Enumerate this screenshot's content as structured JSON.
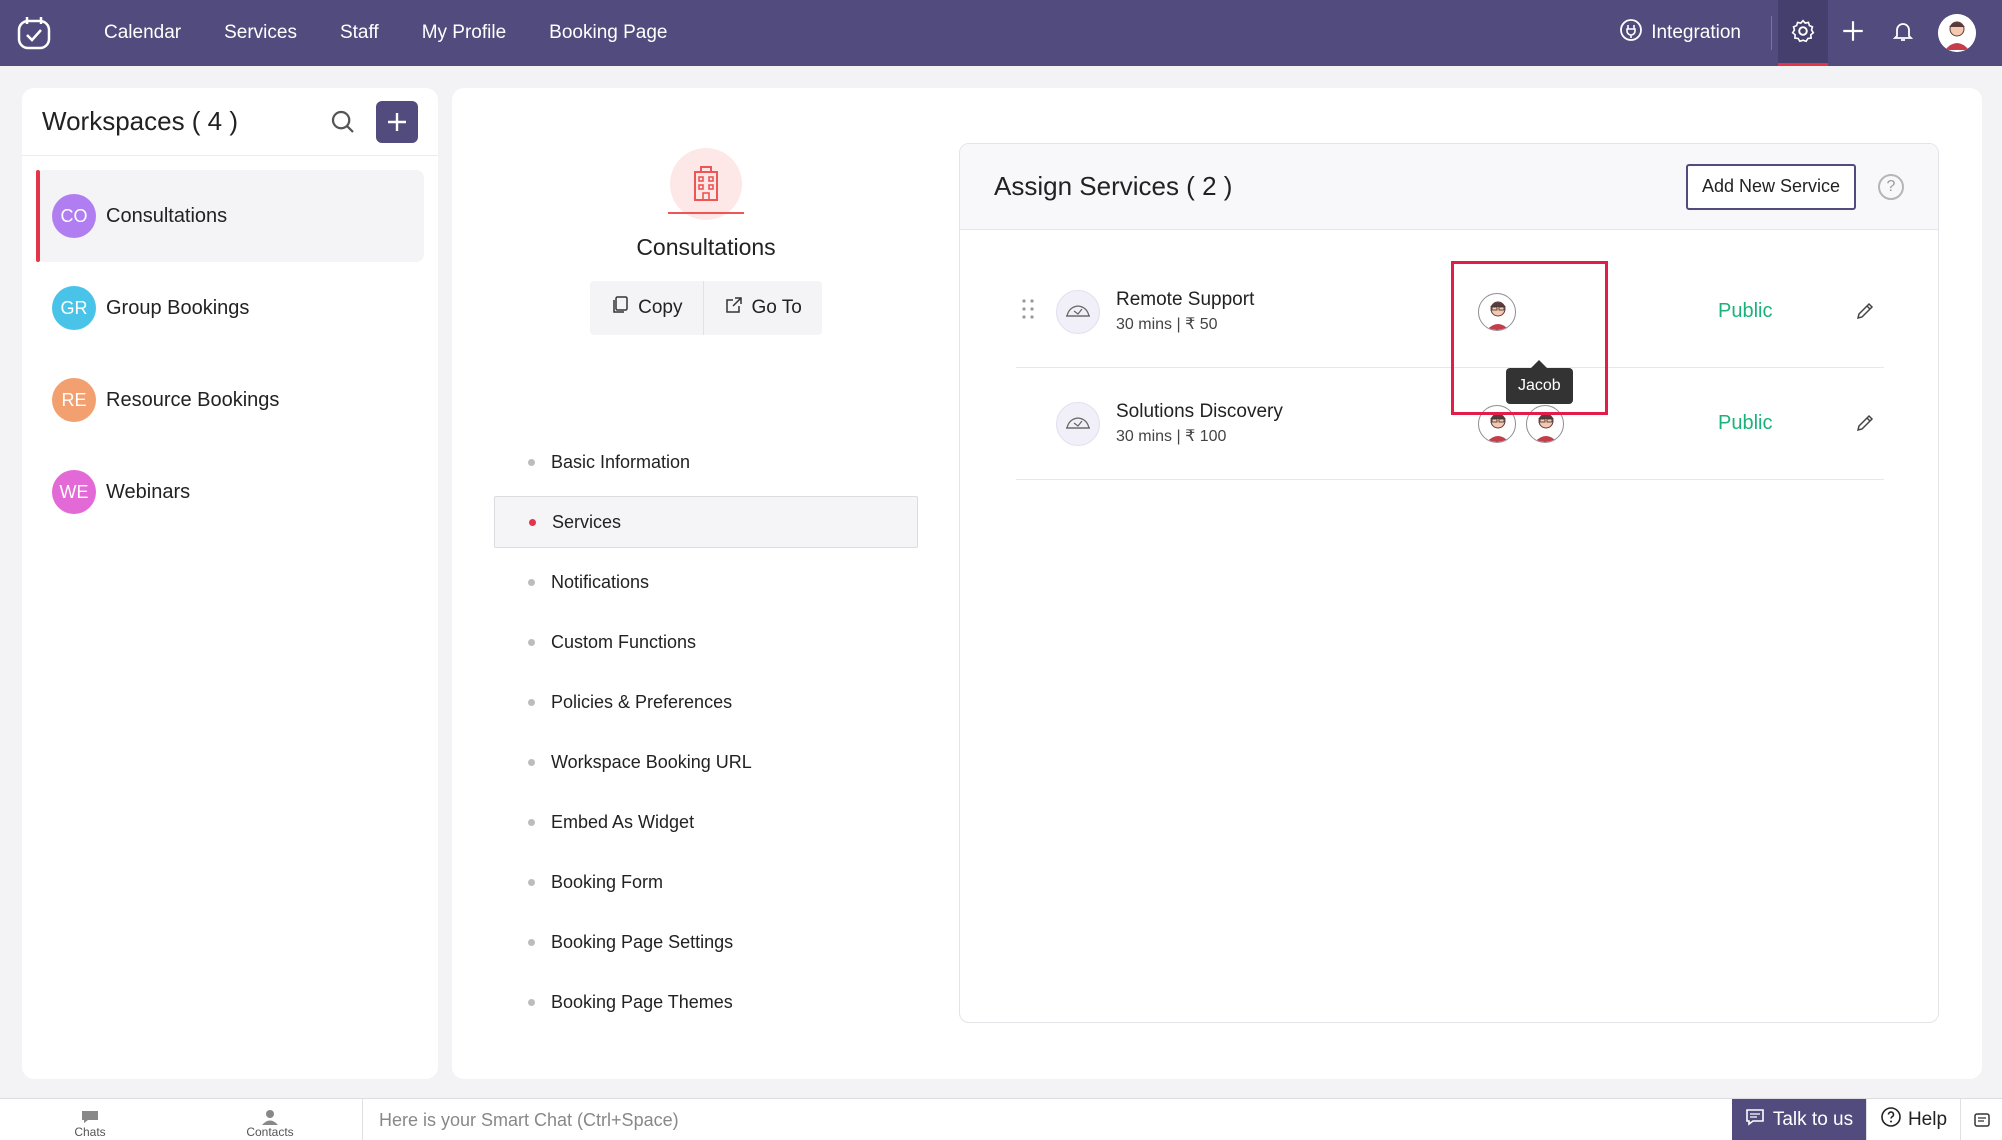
{
  "colors": {
    "brand": "#524b7d",
    "accent_red": "#e3344a",
    "public_green": "#19b37a",
    "highlight": "#e11d48"
  },
  "topbar": {
    "nav": [
      "Calendar",
      "Services",
      "Staff",
      "My Profile",
      "Booking Page"
    ],
    "integration_label": "Integration",
    "icons": [
      "app-logo-icon",
      "plug-icon",
      "gear-icon",
      "plus-icon",
      "bell-icon",
      "user-avatar"
    ]
  },
  "workspaces": {
    "title": "Workspaces ( 4 )",
    "items": [
      {
        "initials": "CO",
        "name": "Consultations",
        "color": "#b07ef0",
        "active": true
      },
      {
        "initials": "GR",
        "name": "Group Bookings",
        "color": "#49c4e8",
        "active": false
      },
      {
        "initials": "RE",
        "name": "Resource Bookings",
        "color": "#f2a070",
        "active": false
      },
      {
        "initials": "WE",
        "name": "Webinars",
        "color": "#e36ad6",
        "active": false
      }
    ]
  },
  "workspace_detail": {
    "name": "Consultations",
    "copy_label": "Copy",
    "goto_label": "Go To"
  },
  "settings_menu": [
    {
      "label": "Basic Information",
      "active": false
    },
    {
      "label": "Services",
      "active": true
    },
    {
      "label": "Notifications",
      "active": false
    },
    {
      "label": "Custom Functions",
      "active": false
    },
    {
      "label": "Policies & Preferences",
      "active": false
    },
    {
      "label": "Workspace Booking URL",
      "active": false
    },
    {
      "label": "Embed As Widget",
      "active": false
    },
    {
      "label": "Booking Form",
      "active": false
    },
    {
      "label": "Booking Page Settings",
      "active": false
    },
    {
      "label": "Booking Page Themes",
      "active": false
    }
  ],
  "assign_services": {
    "title": "Assign Services ( 2 )",
    "add_button": "Add New Service",
    "help_glyph": "?",
    "services": [
      {
        "name": "Remote Support",
        "meta": "30 mins | ₹ 50",
        "status": "Public",
        "staff_count": 1
      },
      {
        "name": "Solutions Discovery",
        "meta": "30 mins | ₹ 100",
        "status": "Public",
        "staff_count": 2
      }
    ],
    "tooltip": "Jacob"
  },
  "bottombar": {
    "chats": "Chats",
    "contacts": "Contacts",
    "smart_chat_placeholder": "Here is your Smart Chat (Ctrl+Space)",
    "talk": "Talk to us",
    "help": "Help"
  }
}
